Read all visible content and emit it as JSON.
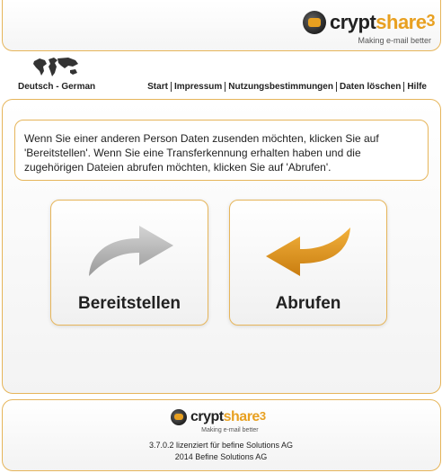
{
  "header": {
    "logo": {
      "word_crypt": "crypt",
      "word_share": "share",
      "version_mark": "3",
      "tagline": "Making e-mail better"
    }
  },
  "language": {
    "label": "Deutsch - German",
    "icon": "world-map-icon"
  },
  "nav": {
    "items": [
      "Start",
      "Impressum",
      "Nutzungsbestimmungen",
      "Daten löschen",
      "Hilfe"
    ]
  },
  "intro": {
    "text": "Wenn Sie einer anderen Person Daten zusenden möchten, klicken Sie auf 'Bereitstellen'. Wenn Sie eine Transferkennung erhalten haben und die zugehörigen Dateien abrufen möchten, klicken Sie auf 'Abrufen'."
  },
  "actions": {
    "provide": {
      "label": "Bereitstellen",
      "icon": "send-arrow-icon",
      "color": "#b8b8b8"
    },
    "retrieve": {
      "label": "Abrufen",
      "icon": "receive-arrow-icon",
      "color": "#e39a1c"
    }
  },
  "footer": {
    "logo": {
      "word_crypt": "crypt",
      "word_share": "share",
      "version_mark": "3",
      "tagline": "Making e-mail better"
    },
    "license": "3.7.0.2 lizenziert für befine Solutions AG",
    "copyright": "2014 Befine Solutions AG"
  },
  "colors": {
    "accent": "#e39a1c",
    "border": "#e6b55a"
  }
}
